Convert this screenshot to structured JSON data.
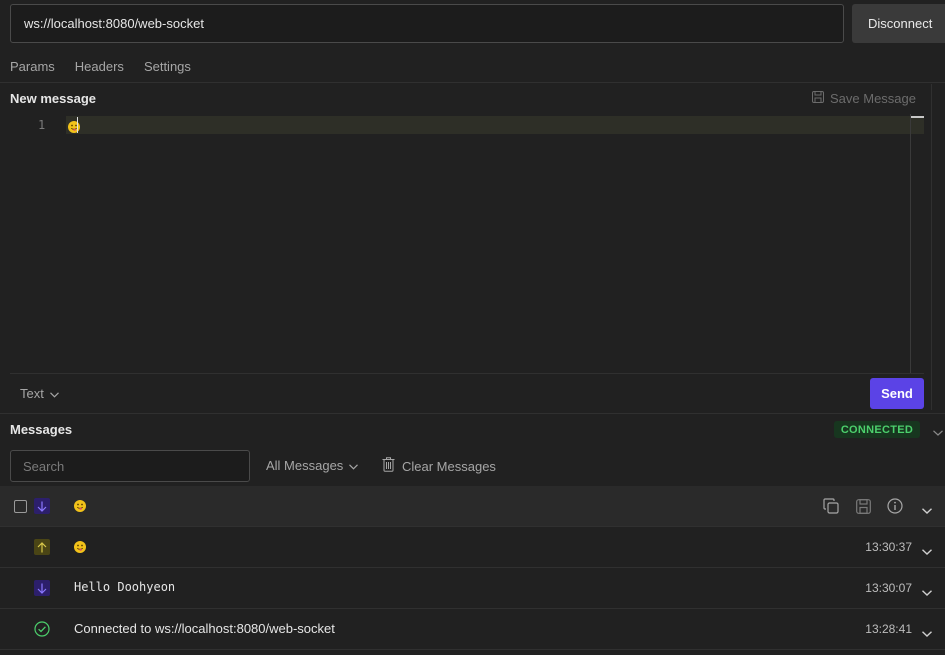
{
  "url": {
    "value": "ws://localhost:8080/web-socket"
  },
  "disconnect_label": "Disconnect",
  "tabs": [
    {
      "label": "Params"
    },
    {
      "label": "Headers"
    },
    {
      "label": "Settings"
    }
  ],
  "composer": {
    "title": "New message",
    "save_label": "Save Message",
    "line_number": "1",
    "content": "😛",
    "format_label": "Text",
    "send_label": "Send"
  },
  "messages_panel": {
    "title": "Messages",
    "status": "CONNECTED",
    "search_placeholder": "Search",
    "filter_label": "All Messages",
    "clear_label": "Clear Messages"
  },
  "messages": [
    {
      "direction": "incoming",
      "content": "😛",
      "time": "",
      "expanded_actions": true
    },
    {
      "direction": "outgoing",
      "content": "😛",
      "time": "13:30:37"
    },
    {
      "direction": "incoming",
      "content": "Hello Doohyeon",
      "time": "13:30:07"
    },
    {
      "direction": "connected",
      "content": "Connected to ws://localhost:8080/web-socket",
      "time": "13:28:41"
    }
  ],
  "icons": {
    "save": "floppy-icon",
    "copy": "copy-icon",
    "info": "info-icon",
    "trash": "trash-icon",
    "chevron": "chevron-down-icon",
    "arrow_down": "arrow-down-icon",
    "arrow_up": "arrow-up-icon",
    "check": "check-circle-icon"
  },
  "colors": {
    "accent": "#5b43e6",
    "connected_text": "#4ccf6c",
    "connected_bg": "#17361f",
    "incoming_bg": "#2c1f6b",
    "outgoing_bg": "#4a4515"
  }
}
